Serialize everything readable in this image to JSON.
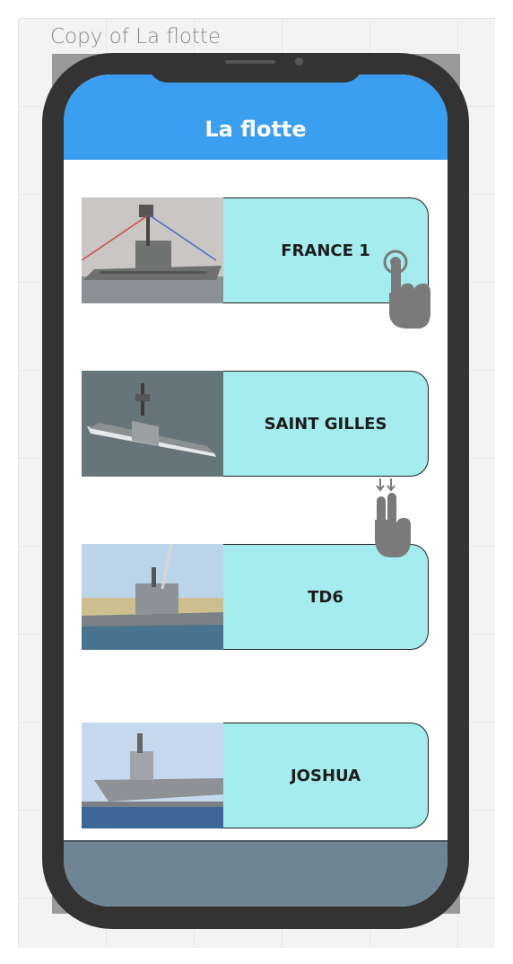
{
  "frame": {
    "title": "Copy of La flotte"
  },
  "app": {
    "title": "La flotte"
  },
  "ships": [
    {
      "name": "FRANCE 1"
    },
    {
      "name": "SAINT GILLES"
    },
    {
      "name": "TD6"
    },
    {
      "name": "JOSHUA"
    }
  ],
  "gestures": {
    "tap": "tap-hand-icon",
    "swipe": "two-finger-swipe-down-icon"
  },
  "colors": {
    "header": "#3a9ff0",
    "card": "#a4eced",
    "footer": "#6f8593",
    "phone": "#333333"
  }
}
